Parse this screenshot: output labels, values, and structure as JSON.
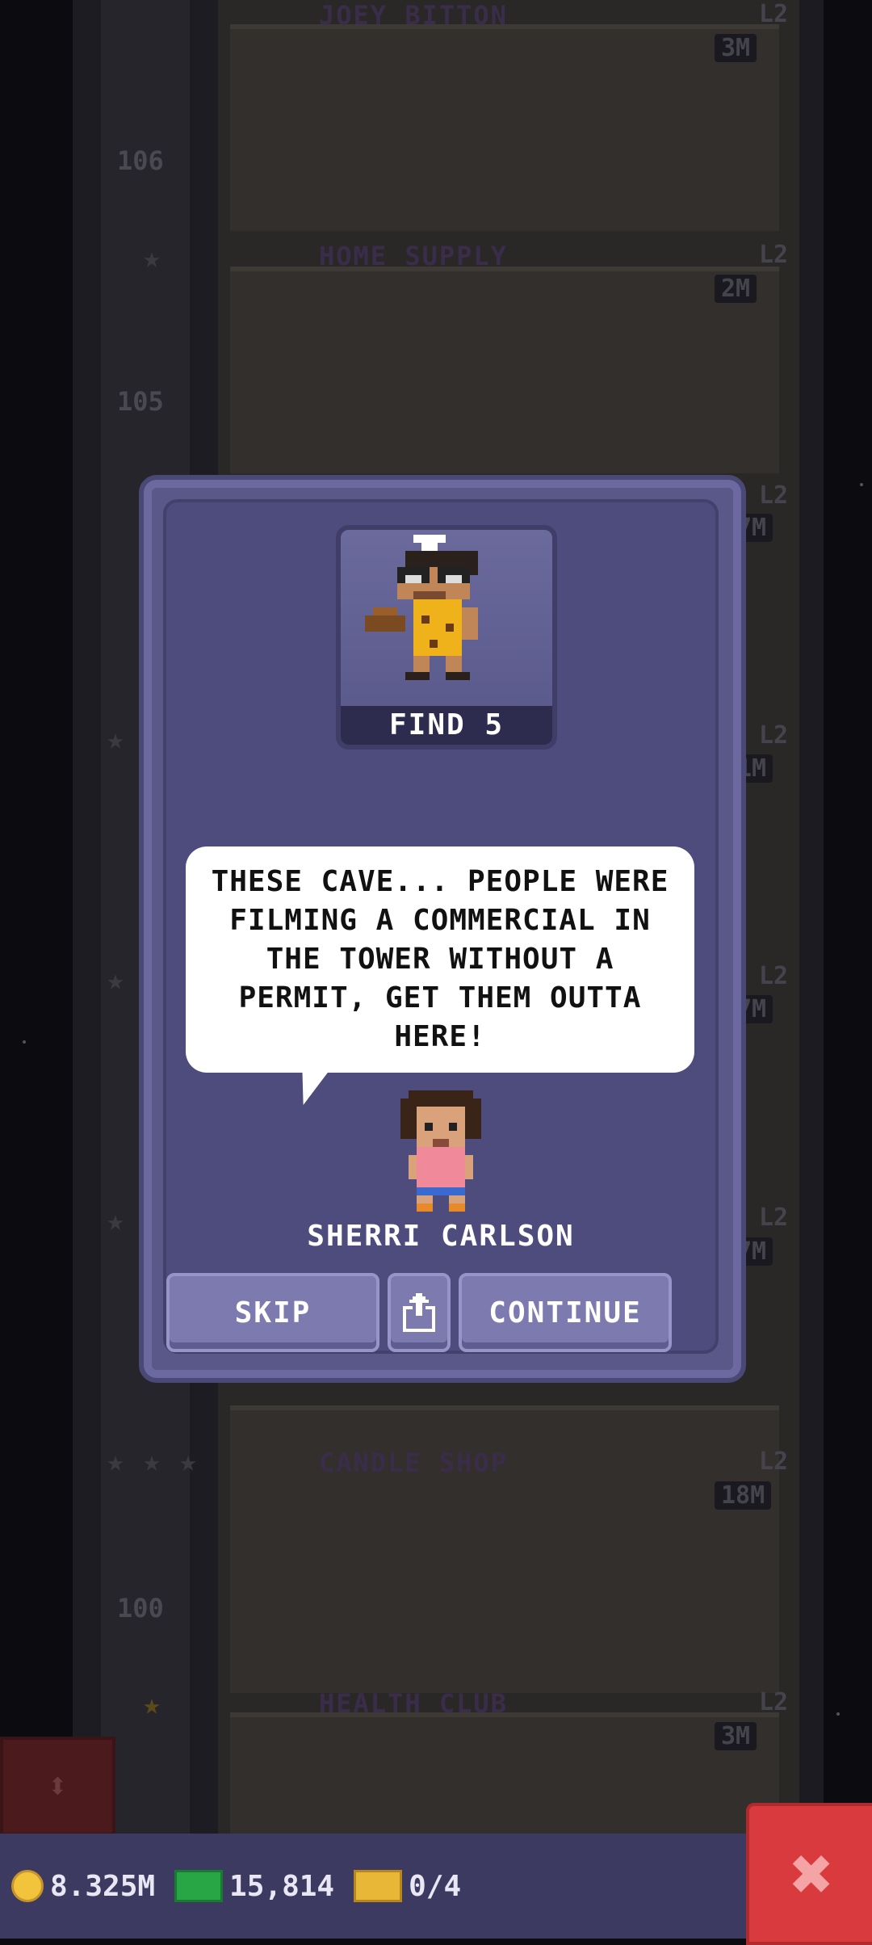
{
  "tower": {
    "floors": [
      {
        "number": "106",
        "name": "JOEY BITTON",
        "level": "L2",
        "price": "3M",
        "sign": "BITT"
      },
      {
        "number": "105",
        "name": "HOME SUPPLY",
        "level": "L2",
        "price": "2M"
      },
      {
        "number": "100",
        "name": "CANDLE SHOP",
        "level": "L2",
        "price": "18M"
      },
      {
        "number": "",
        "name": "HEALTH CLUB",
        "level": "L2",
        "price": "3M"
      }
    ],
    "side_levels": [
      "L2",
      "L2",
      "L2",
      "L2"
    ],
    "side_prices": [
      "7M",
      "1M",
      "7M",
      "7M"
    ]
  },
  "dialog": {
    "quest_badge": "FIND 5",
    "message": "THESE CAVE... PEOPLE WERE FILMING A COMMERCIAL IN THE TOWER WITHOUT A PERMIT, GET THEM OUTTA HERE!",
    "speaker": "SHERRI CARLSON",
    "skip_label": "SKIP",
    "continue_label": "CONTINUE"
  },
  "bottom_bar": {
    "coins": "8.325M",
    "bux": "15,814",
    "tickets": "0/4"
  },
  "colors": {
    "dialog": "#5a5888",
    "button": "#7c7aae",
    "close": "#d83a3d"
  }
}
